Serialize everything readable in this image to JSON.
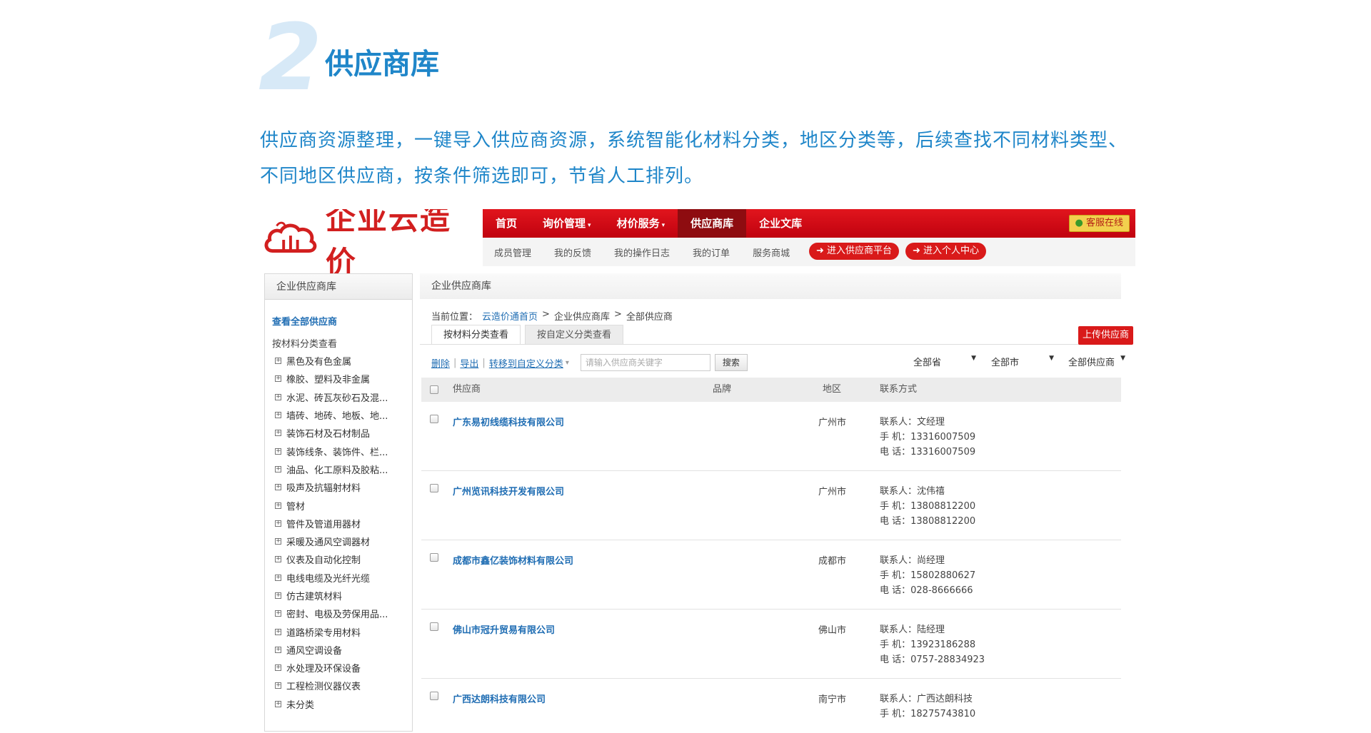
{
  "header": {
    "number": "2",
    "title": "供应商库",
    "description": "供应商资源整理，一键导入供应商资源，系统智能化材料分类，地区分类等，后续查找不同材料类型、不同地区供应商，按条件筛选即可，节省人工排列。"
  },
  "app": {
    "logo_text": "企业云造价",
    "nav": [
      {
        "label": "首页",
        "caret": ""
      },
      {
        "label": "询价管理",
        "caret": "▾"
      },
      {
        "label": "材价服务",
        "caret": "▾"
      },
      {
        "label": "供应商库",
        "caret": ""
      },
      {
        "label": "企业文库",
        "caret": ""
      }
    ],
    "kefu_label": "客服在线",
    "subnav": [
      "成员管理",
      "我的反馈",
      "我的操作日志",
      "我的订单",
      "服务商城"
    ],
    "enter_supplier_platform": "➜ 进入供应商平台",
    "enter_personal_center": "➜ 进入个人中心"
  },
  "sidebar": {
    "title": "企业供应商库",
    "view_all": "查看全部供应商",
    "by_category": "按材料分类查看",
    "categories": [
      "黑色及有色金属",
      "橡胶、塑料及非金属",
      "水泥、砖瓦灰砂石及混...",
      "墙砖、地砖、地板、地...",
      "装饰石材及石材制品",
      "装饰线条、装饰件、栏...",
      "油品、化工原料及胶粘...",
      "吸声及抗辐射材料",
      "管材",
      "管件及管道用器材",
      "采暖及通风空调器材",
      "仪表及自动化控制",
      "电线电缆及光纤光缆",
      "仿古建筑材料",
      "密封、电极及劳保用品...",
      "道路桥梁专用材料",
      "通风空调设备",
      "水处理及环保设备",
      "工程检测仪器仪表",
      "未分类"
    ]
  },
  "main": {
    "title": "企业供应商库",
    "breadcrumb": {
      "prefix": "当前位置：",
      "home": "云造价通首页",
      "level2": "企业供应商库",
      "level3": "全部供应商",
      "sep": ">"
    },
    "tabs": [
      "按材料分类查看",
      "按自定义分类查看"
    ],
    "upload_label": "上传供应商",
    "toolbar": {
      "delete": "删除",
      "export": "导出",
      "move": "转移到自定义分类",
      "move_caret": "▾",
      "sep": "|",
      "search_placeholder": "请输入供应商关键字",
      "search_button": "搜索",
      "province": "全部省",
      "city": "全部市",
      "supplier_filter": "全部供应商",
      "dropdown_arrow": "▼"
    },
    "columns": {
      "supplier": "供应商",
      "brand": "品牌",
      "region": "地区",
      "contact": "联系方式"
    },
    "rows": [
      {
        "name": "广东易初线缆科技有限公司",
        "region": "广州市",
        "contact": "联系人：文经理",
        "mobile": "手 机：13316007509",
        "phone": "电 话：13316007509"
      },
      {
        "name": "广州览讯科技开发有限公司",
        "region": "广州市",
        "contact": "联系人：沈伟禧",
        "mobile": "手 机：13808812200",
        "phone": "电 话：13808812200"
      },
      {
        "name": "成都市鑫亿装饰材料有限公司",
        "region": "成都市",
        "contact": "联系人：尚经理",
        "mobile": "手 机：15802880627",
        "phone": "电 话：028-8666666"
      },
      {
        "name": "佛山市冠升贸易有限公司",
        "region": "佛山市",
        "contact": "联系人：陆经理",
        "mobile": "手 机：13923186288",
        "phone": "电 话：0757-28834923"
      },
      {
        "name": "广西达朗科技有限公司",
        "region": "南宁市",
        "contact": "联系人：广西达朗科技",
        "mobile": "手 机：18275743810",
        "phone": ""
      }
    ]
  },
  "colors": {
    "accent_blue": "#1f86c9",
    "nav_red": "#d0021b",
    "link_blue": "#1f6db3"
  }
}
